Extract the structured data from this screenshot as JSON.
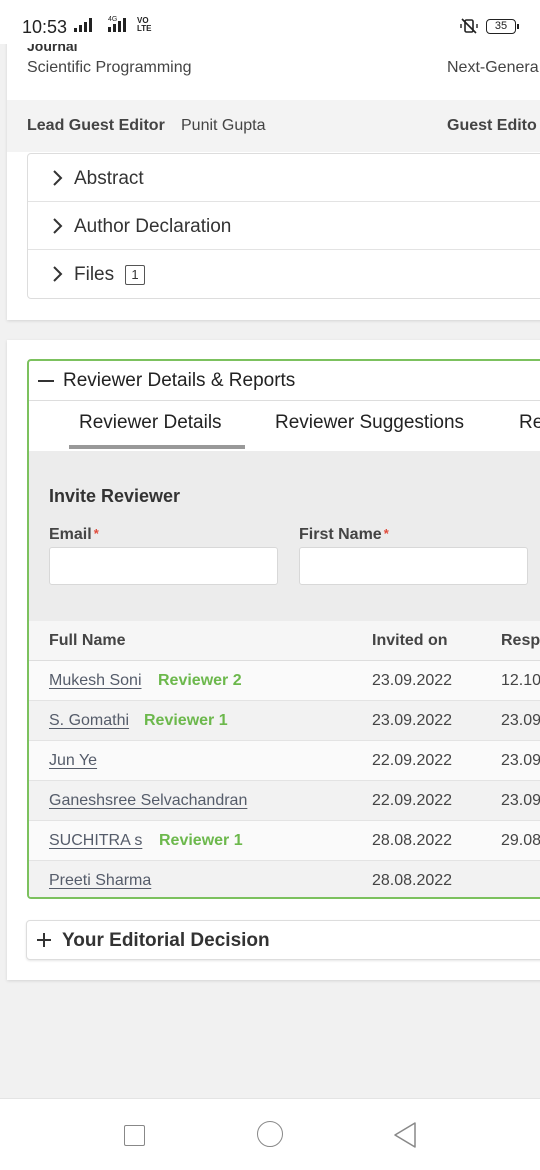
{
  "status_bar": {
    "time": "10:53",
    "network": "4G",
    "volte": "VO\nLTE",
    "battery": "35"
  },
  "manuscript": {
    "journal_label": "Journal",
    "journal_name": "Scientific Programming",
    "special_issue_partial": "Next-Genera",
    "lead_guest_editor_label": "Lead Guest Editor",
    "lead_guest_editor_name": "Punit Gupta",
    "guest_editor_label_partial": "Guest Edito",
    "sections": [
      {
        "label": "Abstract"
      },
      {
        "label": "Author Declaration"
      },
      {
        "label": "Files",
        "badge": "1"
      }
    ]
  },
  "reviewers": {
    "panel_title": "Reviewer Details & Reports",
    "tabs": [
      {
        "label": "Reviewer Details",
        "active": true
      },
      {
        "label": "Reviewer Suggestions",
        "active": false
      },
      {
        "label": "Re",
        "active": false
      }
    ],
    "invite": {
      "title": "Invite Reviewer",
      "email_label": "Email",
      "first_name_label": "First Name",
      "required_mark": "*"
    },
    "table": {
      "headers": {
        "full_name": "Full Name",
        "invited_on": "Invited on",
        "response": "Resp"
      },
      "rows": [
        {
          "name": "Mukesh Soni",
          "role": "Reviewer 2",
          "invited": "23.09.2022",
          "response": "12.10"
        },
        {
          "name": "S. Gomathi",
          "role": "Reviewer 1",
          "invited": "23.09.2022",
          "response": "23.09"
        },
        {
          "name": "Jun Ye",
          "role": "",
          "invited": "22.09.2022",
          "response": "23.09"
        },
        {
          "name": "Ganeshsree Selvachandran",
          "role": "",
          "invited": "22.09.2022",
          "response": "23.09"
        },
        {
          "name": "SUCHITRA s",
          "role": "Reviewer 1",
          "invited": "28.08.2022",
          "response": "29.08"
        },
        {
          "name": "Preeti Sharma",
          "role": "",
          "invited": "28.08.2022",
          "response": ""
        }
      ]
    }
  },
  "decision": {
    "title": "Your Editorial Decision"
  },
  "colors": {
    "accent_green": "#7cc15e",
    "role_green": "#6cb84c",
    "required_red": "#e04a3a"
  }
}
